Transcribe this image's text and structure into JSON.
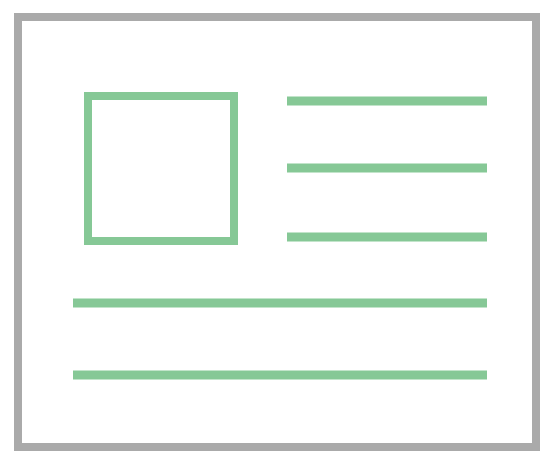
{
  "icon": {
    "name": "article-card-icon",
    "colors": {
      "frame": "#aaaaaa",
      "accent": "#86c896",
      "background": "#ffffff"
    },
    "elements": {
      "image_placeholder": "square-outline",
      "text_lines_beside_image": 3,
      "text_lines_full_width": 2
    }
  }
}
